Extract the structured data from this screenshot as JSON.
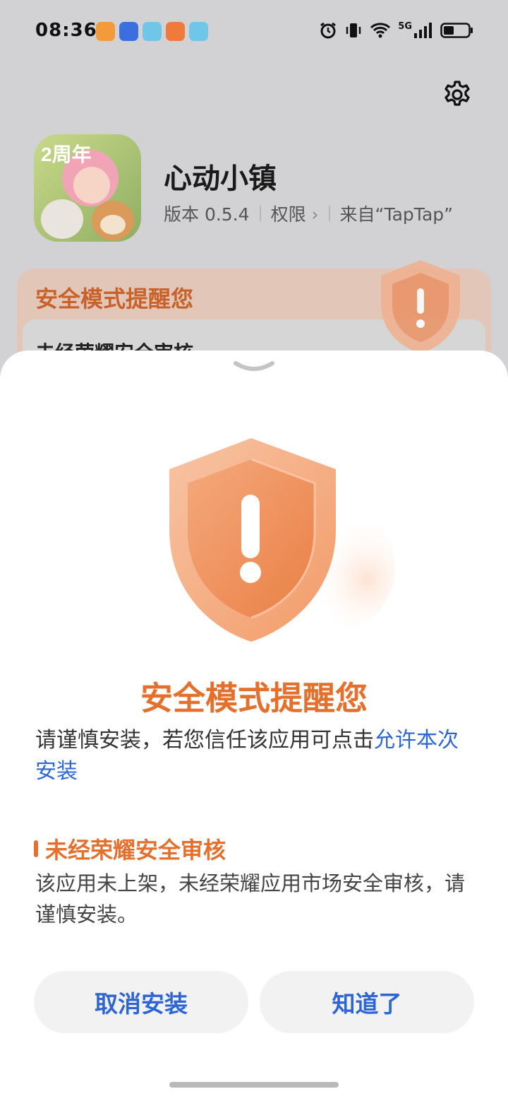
{
  "status_bar": {
    "time": "08:36",
    "network_label": "5G",
    "notification_icons": [
      "health-icon",
      "app-market-icon",
      "reader-icon",
      "video-app-icon",
      "reader-icon"
    ],
    "right_icons": [
      "alarm-icon",
      "vibrate-icon",
      "wifi-icon",
      "signal-icon",
      "battery-icon"
    ]
  },
  "app": {
    "name": "心动小镇",
    "version": "版本 0.5.4",
    "permissions": "权限",
    "source": "来自“TapTap”",
    "icon_badge": "2周年"
  },
  "background_card": {
    "title": "安全模式提醒您",
    "item_text": "未经荣耀安全审核"
  },
  "sheet": {
    "title": "安全模式提醒您",
    "description_prefix": "请谨慎安装，若您信任该应用可点击",
    "description_link": "允许本次安装",
    "section_title": "未经荣耀安全审核",
    "section_text": "该应用未上架，未经荣耀应用市场安全审核，请谨慎安装。",
    "cancel_button": "取消安装",
    "ok_button": "知道了"
  },
  "colors": {
    "accent_orange": "#e4702e",
    "link_blue": "#2d66d4",
    "sheet_bg": "#ffffff",
    "dim_bg": "#d2d2d4"
  }
}
